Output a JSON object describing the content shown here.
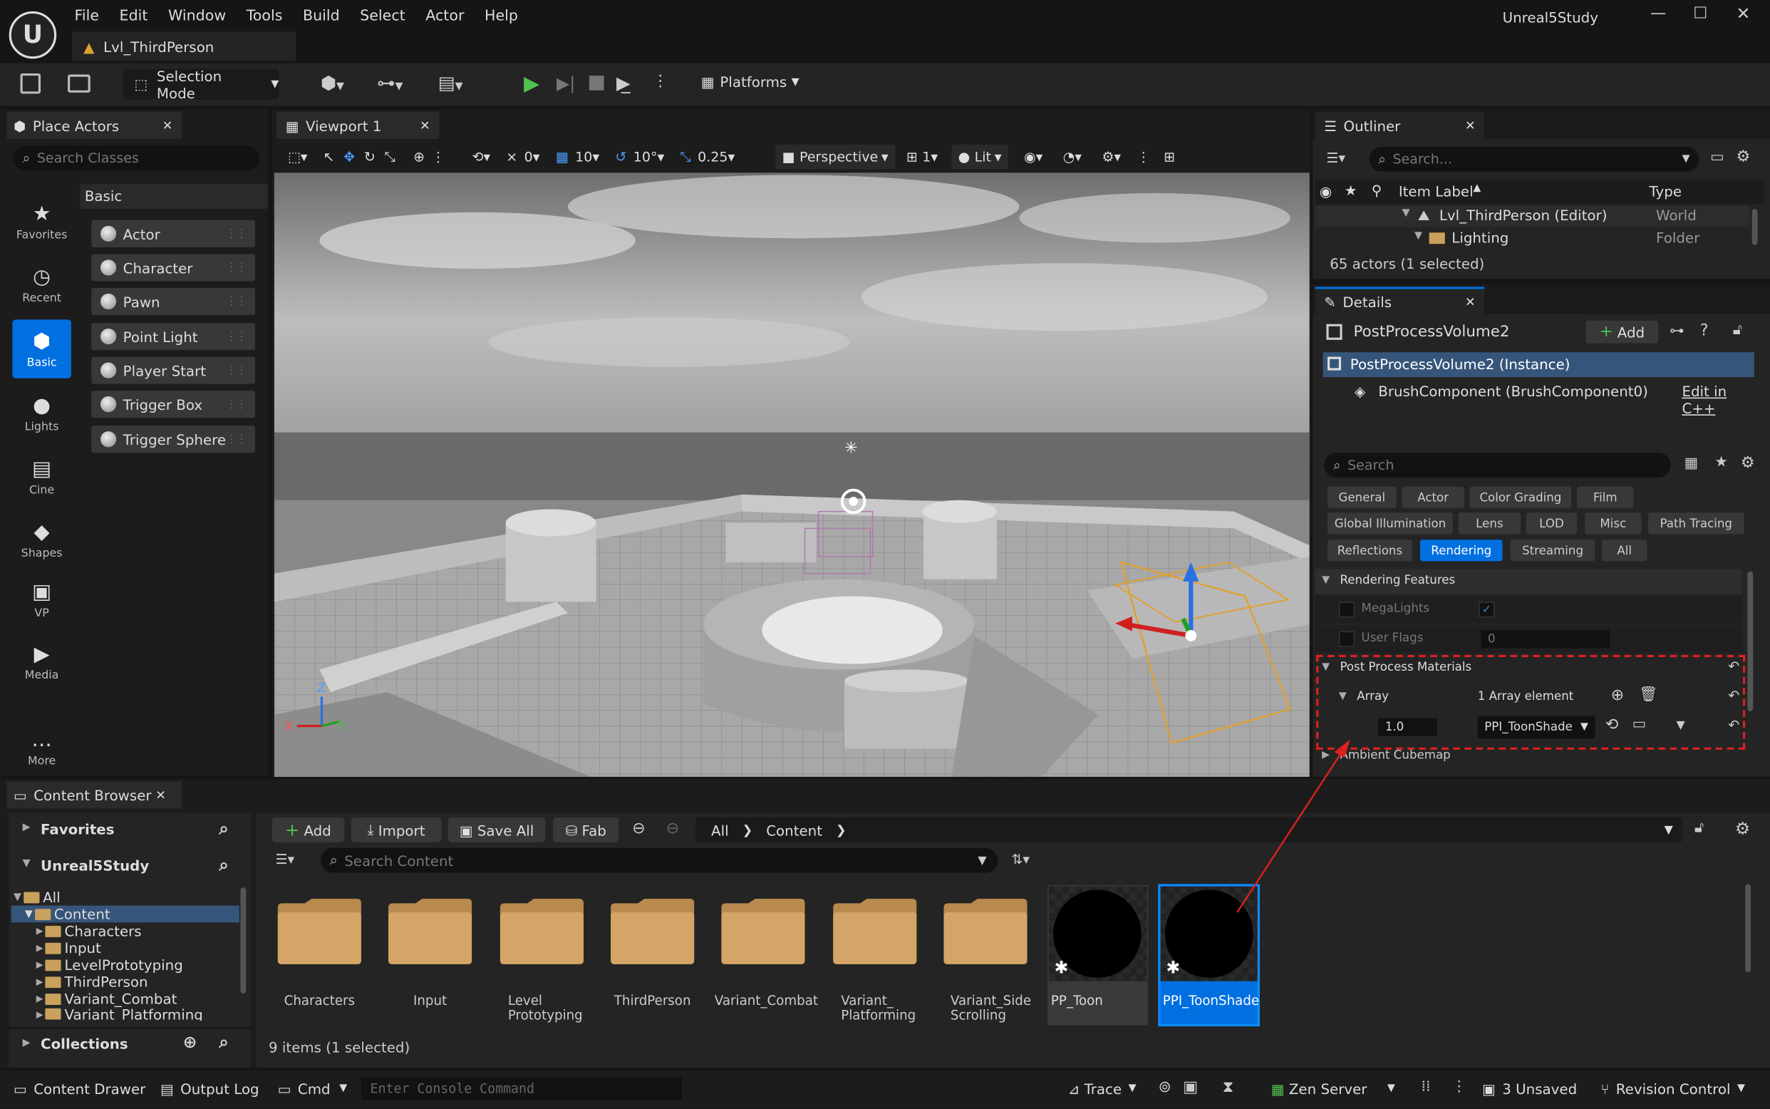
{
  "app": {
    "project": "Unreal5Study",
    "level_tab": "Lvl_ThirdPerson"
  },
  "menu": [
    "File",
    "Edit",
    "Window",
    "Tools",
    "Build",
    "Select",
    "Actor",
    "Help"
  ],
  "toolbar": {
    "selection_mode": "Selection Mode",
    "platforms": "Platforms"
  },
  "place_actors": {
    "tab": "Place Actors",
    "search_placeholder": "Search Classes",
    "section": "Basic",
    "categories": [
      "Favorites",
      "Recent",
      "Basic",
      "Lights",
      "Cine",
      "Shapes",
      "VP",
      "Media",
      "More"
    ],
    "items": [
      "Actor",
      "Character",
      "Pawn",
      "Point Light",
      "Player Start",
      "Trigger Box",
      "Trigger Sphere"
    ]
  },
  "viewport": {
    "tab": "Viewport 1",
    "rotation_snap": "0",
    "grid_snap": "10",
    "angle_snap": "10°",
    "scale_snap": "0.25",
    "perspective": "Perspective",
    "camera_speed": "1",
    "view_mode": "Lit",
    "axis_z": "Z",
    "axis_x": "X",
    "axis_y": "Y"
  },
  "outliner": {
    "tab": "Outliner",
    "search_placeholder": "Search...",
    "col_label": "Item Label",
    "col_type": "Type",
    "rows": [
      {
        "label": "Lvl_ThirdPerson (Editor)",
        "type": "World"
      },
      {
        "label": "Lighting",
        "type": "Folder"
      }
    ],
    "status": "65 actors (1 selected)"
  },
  "details": {
    "tab": "Details",
    "object": "PostProcessVolume2",
    "add": "Add",
    "instance": "PostProcessVolume2 (Instance)",
    "component": "BrushComponent (BrushComponent0)",
    "edit_cpp": "Edit in C++",
    "search_placeholder": "Search",
    "categories_row1": [
      "General",
      "Actor",
      "Color Grading",
      "Film"
    ],
    "categories_row2": [
      "Global Illumination",
      "Lens",
      "LOD",
      "Misc",
      "Path Tracing"
    ],
    "categories_row3": [
      "Reflections",
      "Rendering",
      "Streaming",
      "All"
    ],
    "active_category": "Rendering",
    "section": "Rendering Features",
    "props": {
      "megalights": "MegaLights",
      "user_flags": "User Flags",
      "user_flags_value": "0",
      "ppm": "Post Process Materials",
      "array": "Array",
      "array_count": "1 Array element",
      "weight": "1.0",
      "material": "PPI_ToonShade",
      "ambient": "Ambient Cubemap"
    }
  },
  "content_browser": {
    "tab": "Content Browser",
    "favorites": "Favorites",
    "project": "Unreal5Study",
    "collections": "Collections",
    "add": "Add",
    "import": "Import",
    "save_all": "Save All",
    "fab": "Fab",
    "path": [
      "All",
      "Content"
    ],
    "search_placeholder": "Search Content",
    "tree": [
      "All",
      "Content",
      "Characters",
      "Input",
      "LevelPrototyping",
      "ThirdPerson",
      "Variant_Combat",
      "Variant_Platforming"
    ],
    "assets": [
      {
        "name": "Characters"
      },
      {
        "name": "Input"
      },
      {
        "name": "Level Prototyping"
      },
      {
        "name": "ThirdPerson"
      },
      {
        "name": "Variant_Combat"
      },
      {
        "name": "Variant_ Platforming"
      },
      {
        "name": "Variant_Side Scrolling"
      }
    ],
    "materials": [
      {
        "name": "PP_Toon",
        "selected": false
      },
      {
        "name": "PPI_ToonShade",
        "selected": true
      }
    ],
    "status": "9 items (1 selected)"
  },
  "statusbar": {
    "content_drawer": "Content Drawer",
    "output_log": "Output Log",
    "cmd": "Cmd",
    "console_placeholder": "Enter Console Command",
    "trace": "Trace",
    "zen": "Zen Server",
    "unsaved": "3 Unsaved",
    "revision": "Revision Control"
  },
  "colors": {
    "accent": "#0070e0",
    "highlight_red": "#e02020",
    "selected_row": "#36557a"
  }
}
